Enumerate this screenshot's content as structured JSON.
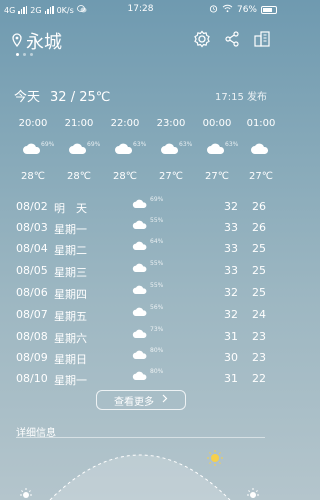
{
  "status": {
    "net1": "4G",
    "net2": "2G",
    "speed": "0K/s",
    "time": "17:28",
    "battery": "76%"
  },
  "header": {
    "city": "永城",
    "icons": [
      "location-icon",
      "settings-icon",
      "share-icon",
      "city-manage-icon"
    ]
  },
  "today": {
    "label": "今天",
    "temp": "32 / 25℃",
    "publish": "17:15 发布"
  },
  "hourly": [
    {
      "time": "20:00",
      "pct": "69%",
      "temp": "28℃"
    },
    {
      "time": "21:00",
      "pct": "69%",
      "temp": "28℃"
    },
    {
      "time": "22:00",
      "pct": "63%",
      "temp": "28℃"
    },
    {
      "time": "23:00",
      "pct": "63%",
      "temp": "27℃"
    },
    {
      "time": "00:00",
      "pct": "63%",
      "temp": "27℃"
    },
    {
      "time": "01:00",
      "pct": "",
      "temp": "27℃"
    }
  ],
  "daily": [
    {
      "date": "08/02",
      "weekday": "明　天",
      "pct": "69%",
      "hi": "32",
      "lo": "26"
    },
    {
      "date": "08/03",
      "weekday": "星期一",
      "pct": "55%",
      "hi": "33",
      "lo": "26"
    },
    {
      "date": "08/04",
      "weekday": "星期二",
      "pct": "64%",
      "hi": "33",
      "lo": "25"
    },
    {
      "date": "08/05",
      "weekday": "星期三",
      "pct": "55%",
      "hi": "33",
      "lo": "25"
    },
    {
      "date": "08/06",
      "weekday": "星期四",
      "pct": "55%",
      "hi": "32",
      "lo": "25"
    },
    {
      "date": "08/07",
      "weekday": "星期五",
      "pct": "56%",
      "hi": "32",
      "lo": "24"
    },
    {
      "date": "08/08",
      "weekday": "星期六",
      "pct": "73%",
      "hi": "31",
      "lo": "23"
    },
    {
      "date": "08/09",
      "weekday": "星期日",
      "pct": "80%",
      "hi": "30",
      "lo": "23"
    },
    {
      "date": "08/10",
      "weekday": "星期一",
      "pct": "80%",
      "hi": "31",
      "lo": "22"
    }
  ],
  "more_label": "查看更多",
  "detail_title": "详细信息",
  "colors": {
    "accent": "#ffffff",
    "sun": "#f7d04a"
  }
}
